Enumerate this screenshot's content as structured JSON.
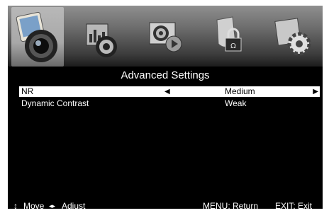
{
  "menu": {
    "tabs": [
      {
        "icon": "picture-icon",
        "active": true
      },
      {
        "icon": "sound-icon",
        "active": false
      },
      {
        "icon": "channel-icon",
        "active": false
      },
      {
        "icon": "lock-icon",
        "active": false
      },
      {
        "icon": "setup-icon",
        "active": false
      }
    ]
  },
  "title": "Advanced Settings",
  "settings": [
    {
      "label": "NR",
      "value": "Medium",
      "selected": true
    },
    {
      "label": "Dynamic Contrast",
      "value": "Weak",
      "selected": false
    }
  ],
  "footer": {
    "move_symbol": "↕",
    "move": "Move",
    "adjust_symbol": "◂▸",
    "adjust": "Adjust",
    "menu_return": "MENU: Return",
    "exit": "EXIT: Exit"
  },
  "arrows": {
    "left": "◀",
    "right": "▶"
  }
}
